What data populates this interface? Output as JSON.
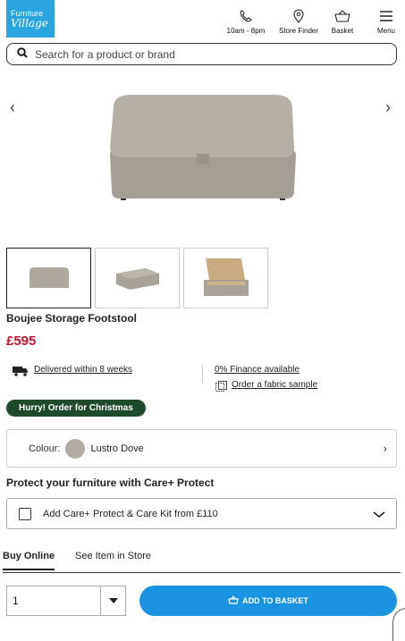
{
  "header": {
    "logo_line1": "Furniture",
    "logo_line2": "Village",
    "nav": [
      {
        "label": "10am - 8pm",
        "icon": "phone-icon"
      },
      {
        "label": "Store Finder",
        "icon": "location-pin-icon"
      },
      {
        "label": "Basket",
        "icon": "basket-icon"
      },
      {
        "label": "Menu",
        "icon": "hamburger-menu-icon"
      }
    ]
  },
  "search": {
    "placeholder": "Search for a product or brand"
  },
  "product": {
    "name": "Boujee Storage Footstool",
    "price": "£595",
    "delivery": "Delivered within 8 weeks",
    "finance": "0% Finance available",
    "sample": "Order a fabric sample",
    "badge": "Hurry! Order for Christmas",
    "colour_label": "Colour:",
    "colour_value": "Lustro Dove",
    "colour_swatch": "#b3aca4"
  },
  "care": {
    "heading": "Protect your furniture with Care+ Protect",
    "option": "Add Care+ Protect & Care Kit from £110"
  },
  "tabs": [
    {
      "label": "Buy Online",
      "active": true
    },
    {
      "label": "See Item in Store",
      "active": false
    }
  ],
  "purchase": {
    "quantity": "1",
    "add_label": "ADD TO BASKET"
  },
  "colors": {
    "brand_blue": "#2aa5e0",
    "button_blue": "#1a94e0",
    "price_red": "#c8102e",
    "badge_green": "#1f4a2c"
  }
}
